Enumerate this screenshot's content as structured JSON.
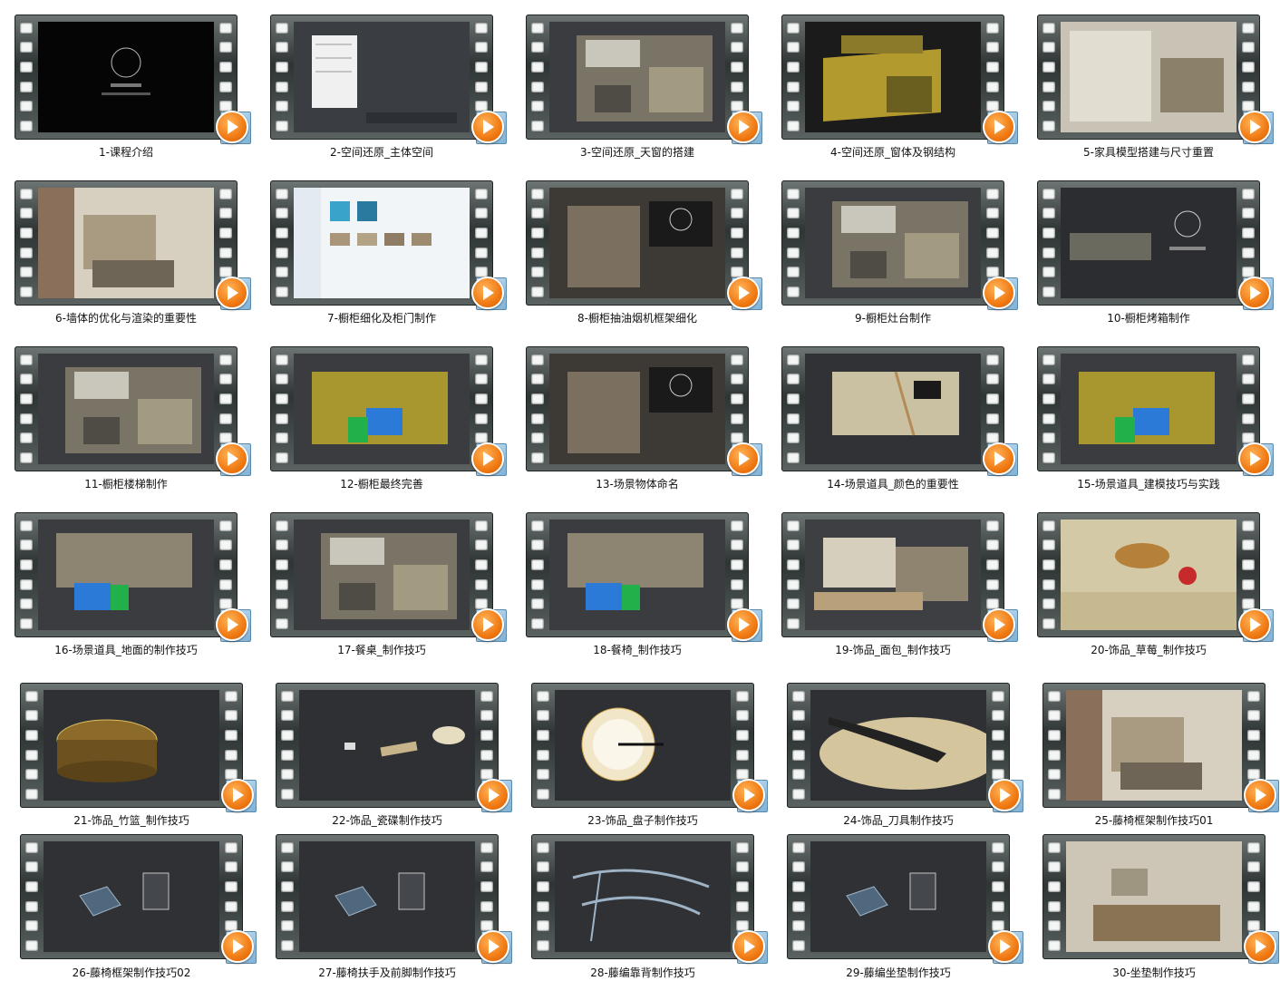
{
  "videos": [
    {
      "label": "1-课程介绍",
      "scene": "black"
    },
    {
      "label": "2-空间还原_主体空间",
      "scene": "menu"
    },
    {
      "label": "3-空间还原_天窗的搭建",
      "scene": "room"
    },
    {
      "label": "4-空间还原_窗体及钢结构",
      "scene": "yellow"
    },
    {
      "label": "5-家具模型搭建与尺寸重置",
      "scene": "room-light"
    },
    {
      "label": "6-墙体的优化与渲染的重要性",
      "scene": "render"
    },
    {
      "label": "7-橱柜细化及柜门制作",
      "scene": "explorer"
    },
    {
      "label": "8-橱柜抽油烟机框架细化",
      "scene": "room-logo"
    },
    {
      "label": "9-橱柜灶台制作",
      "scene": "room"
    },
    {
      "label": "10-橱柜烤箱制作",
      "scene": "dark-logo"
    },
    {
      "label": "11-橱柜楼梯制作",
      "scene": "room"
    },
    {
      "label": "12-橱柜最终完善",
      "scene": "yellow-blue"
    },
    {
      "label": "13-场景物体命名",
      "scene": "room-logo"
    },
    {
      "label": "14-场景道具_颜色的重要性",
      "scene": "cabinet"
    },
    {
      "label": "15-场景道具_建模技巧与实践",
      "scene": "yellow-blue"
    },
    {
      "label": "16-场景道具_地面的制作技巧",
      "scene": "room-blue"
    },
    {
      "label": "17-餐桌_制作技巧",
      "scene": "room"
    },
    {
      "label": "18-餐椅_制作技巧",
      "scene": "room-blue"
    },
    {
      "label": "19-饰品_面包_制作技巧",
      "scene": "table"
    },
    {
      "label": "20-饰品_草莓_制作技巧",
      "scene": "table-close"
    },
    {
      "label": "21-饰品_竹篮_制作技巧",
      "scene": "basket"
    },
    {
      "label": "22-饰品_瓷碟制作技巧",
      "scene": "plates"
    },
    {
      "label": "23-饰品_盘子制作技巧",
      "scene": "plate"
    },
    {
      "label": "24-饰品_刀具制作技巧",
      "scene": "knife"
    },
    {
      "label": "25-藤椅框架制作技巧01",
      "scene": "render"
    },
    {
      "label": "26-藤椅框架制作技巧02",
      "scene": "chair"
    },
    {
      "label": "27-藤椅扶手及前脚制作技巧",
      "scene": "chair"
    },
    {
      "label": "28-藤编靠背制作技巧",
      "scene": "frame"
    },
    {
      "label": "29-藤编坐垫制作技巧",
      "scene": "chair"
    },
    {
      "label": "30-坐垫制作技巧",
      "scene": "render-wall"
    }
  ],
  "icons": {
    "play": "play-icon",
    "film": "film-strip-icon"
  }
}
